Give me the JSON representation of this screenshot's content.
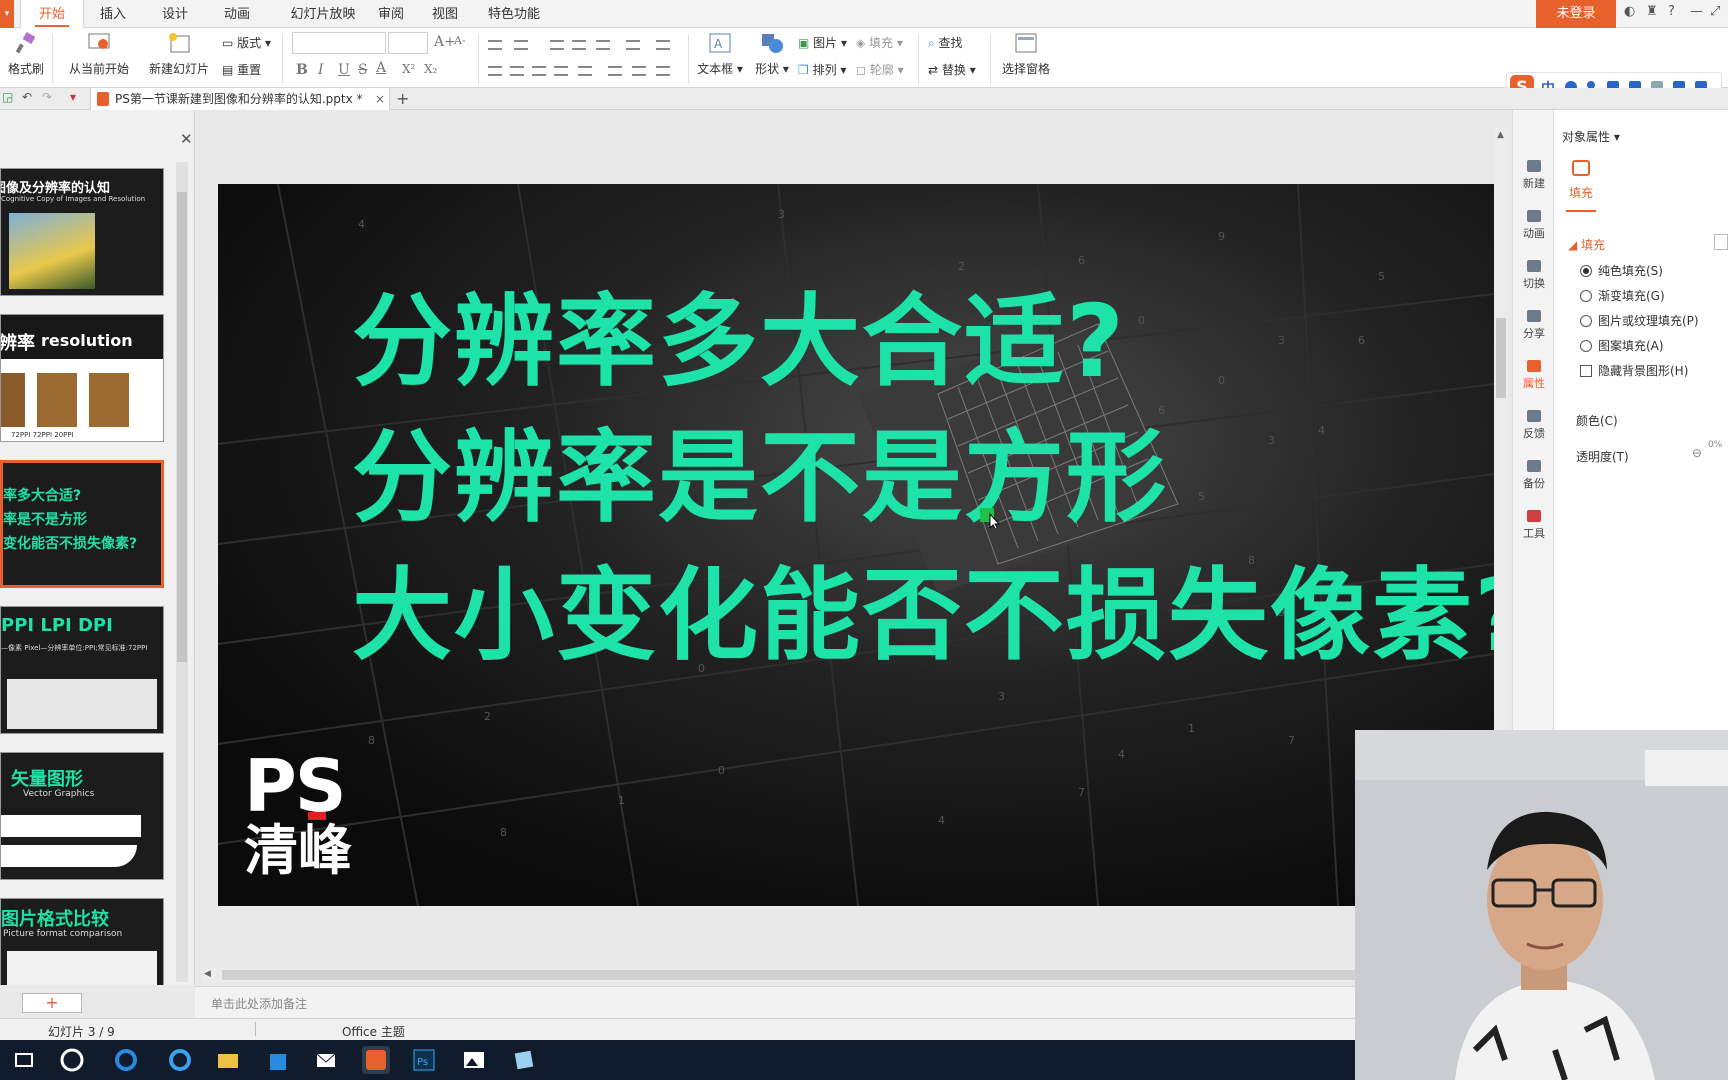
{
  "app": {
    "menu_tabs": [
      "开始",
      "插入",
      "设计",
      "动画",
      "幻灯片放映",
      "审阅",
      "视图",
      "特色功能"
    ],
    "active_tab": "开始",
    "login_label": "未登录",
    "window_controls": [
      "?",
      "—",
      "⤢"
    ]
  },
  "ribbon": {
    "format_painter": "格式刷",
    "from_current": "从当前开始",
    "new_slide": "新建幻灯片",
    "layout": "版式",
    "reset": "重置",
    "font_name": "",
    "font_size": "",
    "grow_font": "A+",
    "shrink_font": "A-",
    "bold": "B",
    "italic": "I",
    "underline": "U",
    "strike": "S",
    "font_color": "A",
    "superscript": "X²",
    "subscript": "X₂",
    "textbox": "文本框",
    "shape": "形状",
    "picture": "图片",
    "fill": "填充",
    "arrange": "排列",
    "outline": "轮廓",
    "find": "查找",
    "replace": "替换",
    "selection_pane": "选择窗格"
  },
  "ime": {
    "logo": "S",
    "lang": "中"
  },
  "document": {
    "tab_title": "PS第一节课新建到图像和分辨率的认知.pptx *",
    "close": "×",
    "new_tab": "+"
  },
  "thumbnails": [
    {
      "title": "章—图像及分辨率的认知",
      "subtitle": "Cognitive Copy of Images and Resolution"
    },
    {
      "title": "辨率",
      "title2": "resolution",
      "subtitle": "72PPI    72PPI    20PPI"
    },
    {
      "line1": "率多大合适?",
      "line2": "率是不是方形",
      "line3": "变化能否不损失像素?"
    },
    {
      "title": "PPI LPI DPI",
      "subtitle": "—像素 Pixel—分辨率单位:PPI;常见标准:72PPI"
    },
    {
      "title": "矢量图形",
      "subtitle": "Vector Graphics"
    },
    {
      "title": "图片格式比较",
      "subtitle": "Picture format comparison"
    }
  ],
  "active_thumbnail": 3,
  "slide": {
    "line1": "分辨率多大合适?",
    "line2": "分辨率是不是方形",
    "line3": "大小变化能否不损失像素?",
    "logo_ps": "PS",
    "logo_brand": "清峰",
    "text_color": "#1ee3a8"
  },
  "notes_placeholder": "单击此处添加备注",
  "status": {
    "slide_counter": "幻灯片 3 / 9",
    "theme": "Office 主题"
  },
  "side_bar": [
    "新建",
    "动画",
    "切换",
    "分享",
    "属性",
    "反馈",
    "备份",
    "工具"
  ],
  "side_active": "属性",
  "properties": {
    "title": "对象属性",
    "fill_tab": "填充",
    "fill_section": "填充",
    "options": [
      "纯色填充(S)",
      "渐变填充(G)",
      "图片或纹理填充(P)",
      "图案填充(A)"
    ],
    "selected_option": 0,
    "hide_bg": "隐藏背景图形(H)",
    "color_label": "颜色(C)",
    "transparency_label": "透明度(T)",
    "transparency_value": "0%"
  },
  "colors": {
    "accent": "#e8612c",
    "slide_text": "#1ee3a8",
    "taskbar": "#101c2c"
  }
}
